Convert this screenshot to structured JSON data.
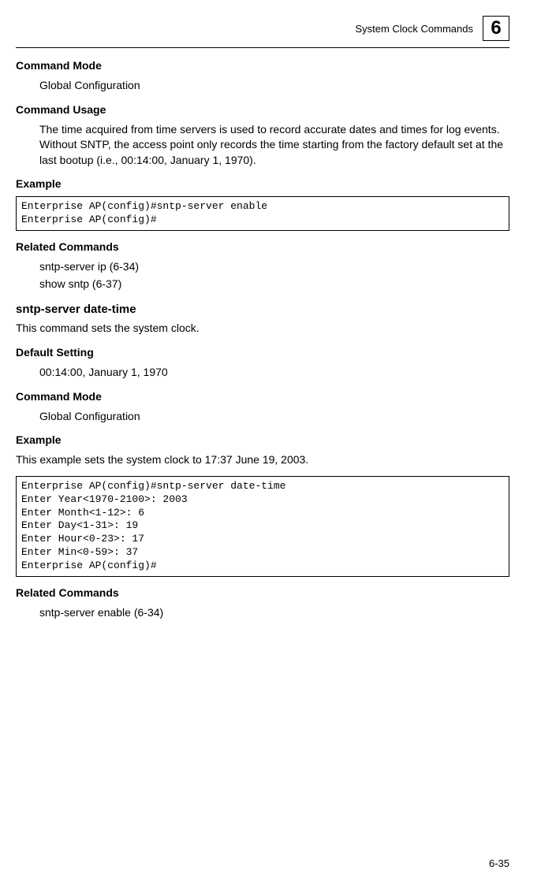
{
  "header": {
    "title": "System Clock Commands",
    "chapter": "6"
  },
  "s1": {
    "cmdModeHeading": "Command Mode",
    "cmdModeText": "Global Configuration",
    "cmdUsageHeading": "Command Usage",
    "cmdUsageText": "The time acquired from time servers is used to record accurate dates and times for log events. Without SNTP, the access point only records the time starting from the factory default set at the last bootup (i.e., 00:14:00, January 1, 1970).",
    "exampleHeading": "Example",
    "code": "Enterprise AP(config)#sntp-server enable\nEnterprise AP(config)#",
    "relatedHeading": "Related Commands",
    "related1": "sntp-server ip (6-34)",
    "related2": "show sntp (6-37)"
  },
  "s2": {
    "title": "sntp-server date-time",
    "desc": "This command sets the system clock.",
    "defaultHeading": "Default Setting",
    "defaultText": "00:14:00, January 1, 1970",
    "cmdModeHeading": "Command Mode",
    "cmdModeText": "Global Configuration",
    "exampleHeading": "Example",
    "exampleDesc": "This example sets the system clock to 17:37 June 19, 2003.",
    "code": "Enterprise AP(config)#sntp-server date-time\nEnter Year<1970-2100>: 2003\nEnter Month<1-12>: 6\nEnter Day<1-31>: 19\nEnter Hour<0-23>: 17\nEnter Min<0-59>: 37\nEnterprise AP(config)#",
    "relatedHeading": "Related Commands",
    "related1": "sntp-server enable (6-34)"
  },
  "pageNumber": "6-35"
}
